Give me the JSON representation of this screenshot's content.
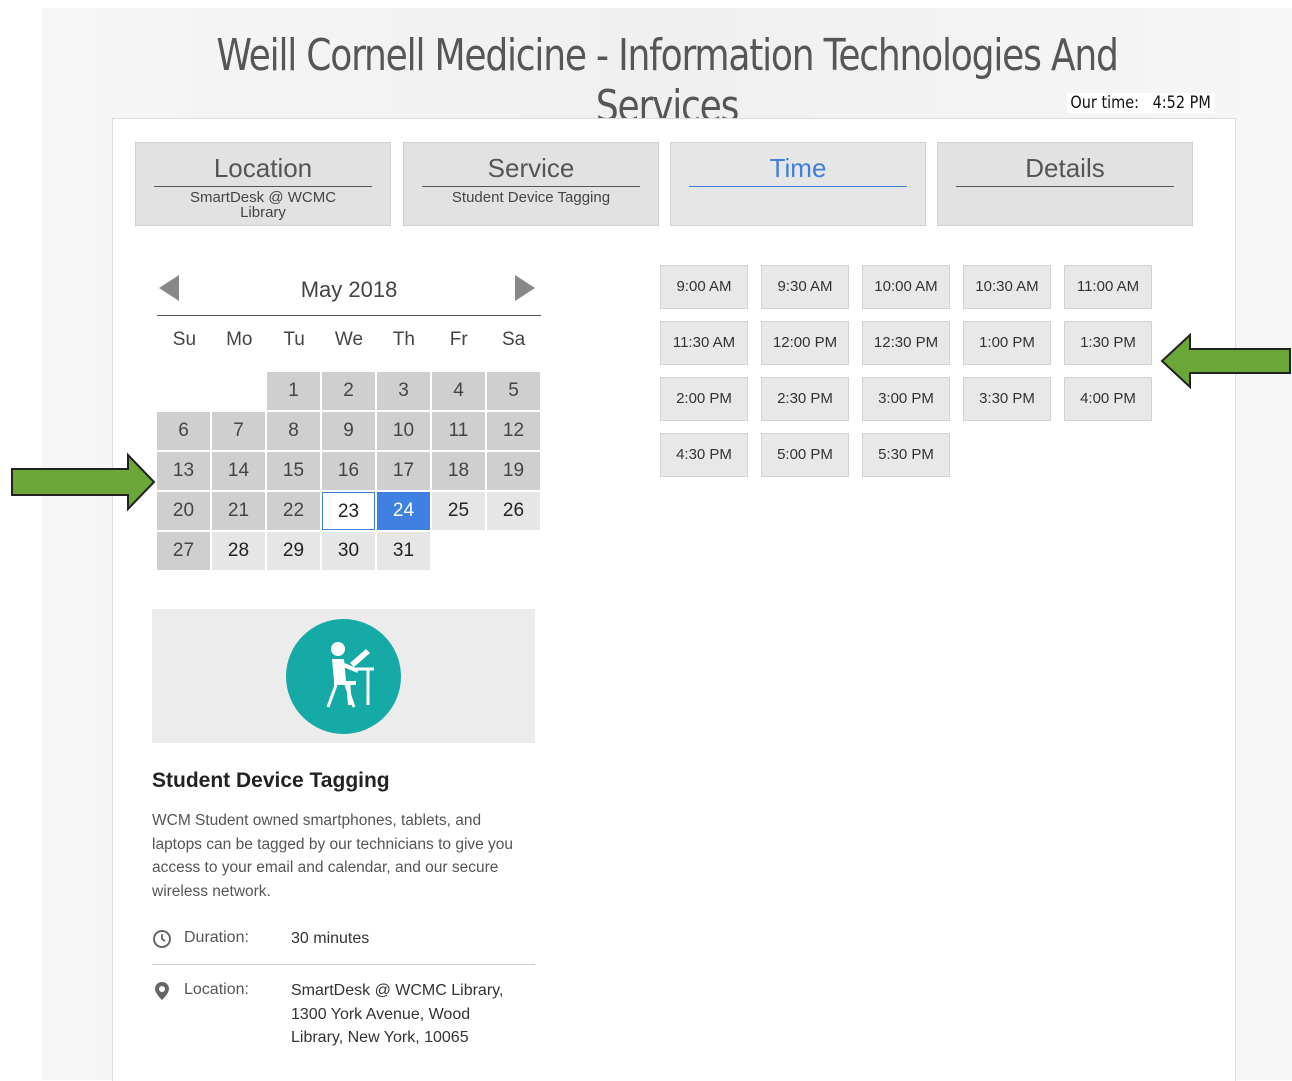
{
  "header": {
    "title": "Weill Cornell Medicine - Information Technologies And Services",
    "our_time_label": "Our time:",
    "our_time_value": "4:52 PM"
  },
  "steps": [
    {
      "title": "Location",
      "subtitle": "SmartDesk @ WCMC Library"
    },
    {
      "title": "Service",
      "subtitle": "Student Device Tagging"
    },
    {
      "title": "Time",
      "subtitle": ""
    },
    {
      "title": "Details",
      "subtitle": ""
    }
  ],
  "calendar": {
    "month_label": "May 2018",
    "weekdays": [
      "Su",
      "Mo",
      "Tu",
      "We",
      "Th",
      "Fr",
      "Sa"
    ],
    "days": [
      "1",
      "2",
      "3",
      "4",
      "5",
      "6",
      "7",
      "8",
      "9",
      "10",
      "11",
      "12",
      "13",
      "14",
      "15",
      "16",
      "17",
      "18",
      "19",
      "20",
      "21",
      "22",
      "23",
      "24",
      "25",
      "26",
      "27",
      "28",
      "29",
      "30",
      "31"
    ],
    "today": "23",
    "selected": "24"
  },
  "time_slots": [
    "9:00 AM",
    "9:30 AM",
    "10:00 AM",
    "10:30 AM",
    "11:00 AM",
    "11:30 AM",
    "12:00 PM",
    "12:30 PM",
    "1:00 PM",
    "1:30 PM",
    "2:00 PM",
    "2:30 PM",
    "3:00 PM",
    "3:30 PM",
    "4:00 PM",
    "4:30 PM",
    "5:00 PM",
    "5:30 PM"
  ],
  "service": {
    "name": "Student Device Tagging",
    "icon": "person-at-laptop-icon",
    "description": "WCM Student owned smartphones, tablets, and laptops can be tagged by our technicians to give you access to your email and calendar, and our secure wireless network.",
    "duration_label": "Duration:",
    "duration_value": "30 minutes",
    "location_label": "Location:",
    "location_value": "SmartDesk @ WCMC Library,  1300 York Avenue, Wood Library, New York, 10065"
  },
  "colors": {
    "accent": "#3f80e0",
    "icon_bg": "#15aaa6",
    "annotation_arrow": "#6aa638"
  }
}
